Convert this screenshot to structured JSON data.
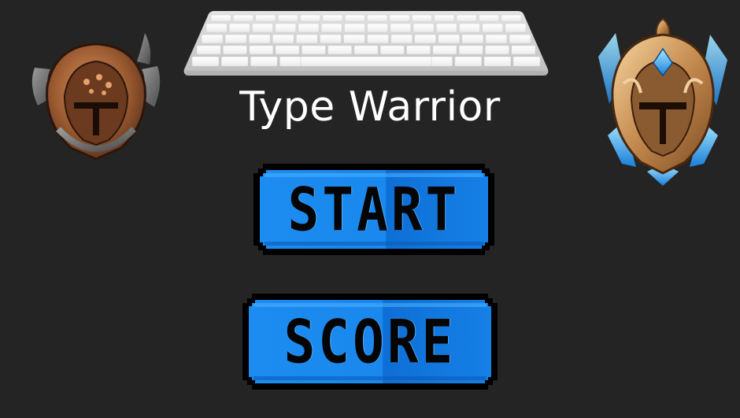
{
  "game": {
    "title": "Type Warrior"
  },
  "menu": {
    "start_label": "START",
    "score_label": "SCORE"
  },
  "icons": {
    "keyboard": "keyboard-icon",
    "left_emblem": "bronze-helmet-icon",
    "right_emblem": "gold-helmet-icon"
  },
  "colors": {
    "background": "#242424",
    "button_blue": "#1a88ee",
    "title_text": "#ffffff"
  }
}
